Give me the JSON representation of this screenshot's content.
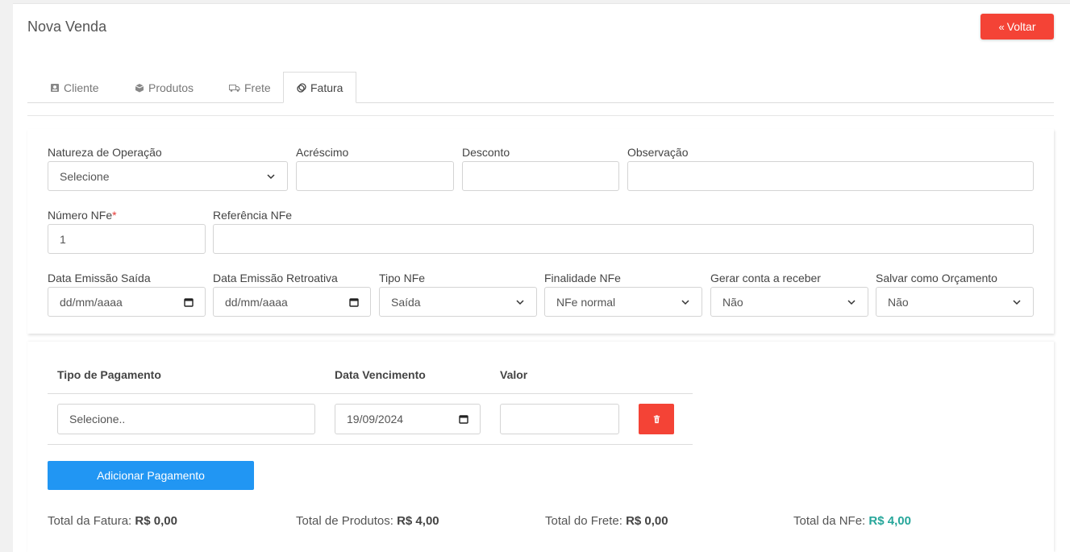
{
  "header": {
    "title": "Nova Venda",
    "back_label": "Voltar"
  },
  "tabs": [
    {
      "label": "Cliente",
      "icon": "contact-card-icon"
    },
    {
      "label": "Produtos",
      "icon": "box-icon"
    },
    {
      "label": "Frete",
      "icon": "truck-icon"
    },
    {
      "label": "Fatura",
      "icon": "coins-icon",
      "active": true
    }
  ],
  "form": {
    "natureza": {
      "label": "Natureza de Operação",
      "value": "Selecione"
    },
    "acrescimo": {
      "label": "Acréscimo",
      "value": ""
    },
    "desconto": {
      "label": "Desconto",
      "value": ""
    },
    "observacao": {
      "label": "Observação",
      "value": ""
    },
    "numero_nfe": {
      "label": "Número NFe",
      "required_mark": "*",
      "value": "1"
    },
    "referencia_nfe": {
      "label": "Referência NFe",
      "value": ""
    },
    "data_emissao_saida": {
      "label": "Data Emissão Saída",
      "value": "dd/mm/aaaa"
    },
    "data_emissao_retroativa": {
      "label": "Data Emissão Retroativa",
      "value": "dd/mm/aaaa"
    },
    "tipo_nfe": {
      "label": "Tipo NFe",
      "value": "Saída"
    },
    "finalidade_nfe": {
      "label": "Finalidade NFe",
      "value": "NFe normal"
    },
    "gerar_conta": {
      "label": "Gerar conta a receber",
      "value": "Não"
    },
    "salvar_orcamento": {
      "label": "Salvar como Orçamento",
      "value": "Não"
    }
  },
  "payments": {
    "headers": [
      "Tipo de Pagamento",
      "Data Vencimento",
      "Valor"
    ],
    "rows": [
      {
        "tipo_placeholder": "Selecione..",
        "vencimento": "19/09/2024",
        "valor": ""
      }
    ],
    "add_label": "Adicionar Pagamento"
  },
  "totals": {
    "fatura_label": "Total da Fatura:",
    "fatura_value": "R$ 0,00",
    "produtos_label": "Total de Produtos:",
    "produtos_value": "R$ 4,00",
    "frete_label": "Total do Frete:",
    "frete_value": "R$ 0,00",
    "nfe_label": "Total da NFe:",
    "nfe_value": "R$ 4,00"
  },
  "colors": {
    "danger": "#f44336",
    "primary": "#2196f3",
    "highlight": "#26a69a"
  }
}
